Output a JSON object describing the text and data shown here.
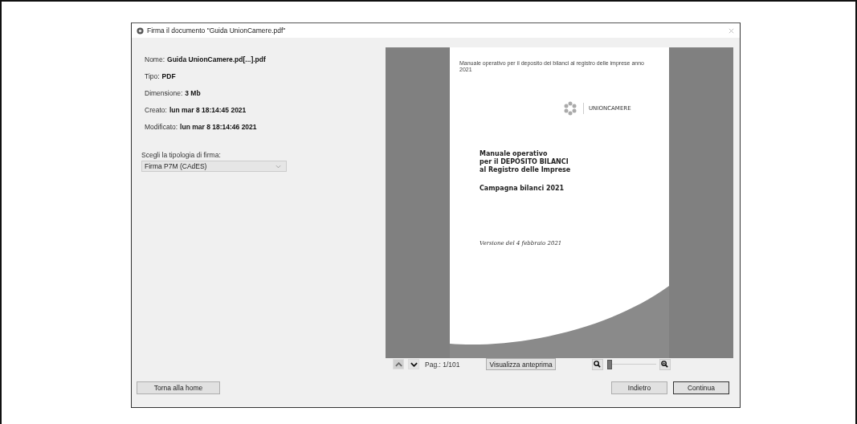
{
  "window": {
    "title": "Firma il documento \"Guida UnionCamere.pdf\""
  },
  "info": [
    {
      "label": "Nome:",
      "value": "Guida UnionCamere.pd[...].pdf"
    },
    {
      "label": "Tipo:",
      "value": "PDF"
    },
    {
      "label": "Dimensione:",
      "value": "3 Mb"
    },
    {
      "label": "Creato:",
      "value": "lun mar 8 18:14:45 2021"
    },
    {
      "label": "Modificato:",
      "value": "lun mar 8 18:14:46 2021"
    }
  ],
  "signature_type": {
    "label": "Scegli la tipologia di firma:",
    "value": "Firma P7M (CAdES)"
  },
  "preview": {
    "header": "Manuale operativo per il deposito dei bilanci al registro delle imprese anno 2021",
    "logo": "UNIONCAMERE",
    "title_lines": [
      "Manuale operativo",
      "per il DEPOSITO BILANCI",
      "al Registro delle Imprese"
    ],
    "subtitle": "Campagna bilanci 2021",
    "version": "Versione del 4 febbraio 2021"
  },
  "navigation": {
    "page": "Pag.: 1/101",
    "preview_button": "Visualizza anteprima",
    "zoom": {
      "level": 0.02
    }
  },
  "buttons": [
    {
      "label": "Torna alla home",
      "default": false
    },
    {
      "label": "Indietro",
      "default": false
    },
    {
      "label": "Continua",
      "default": true
    }
  ]
}
